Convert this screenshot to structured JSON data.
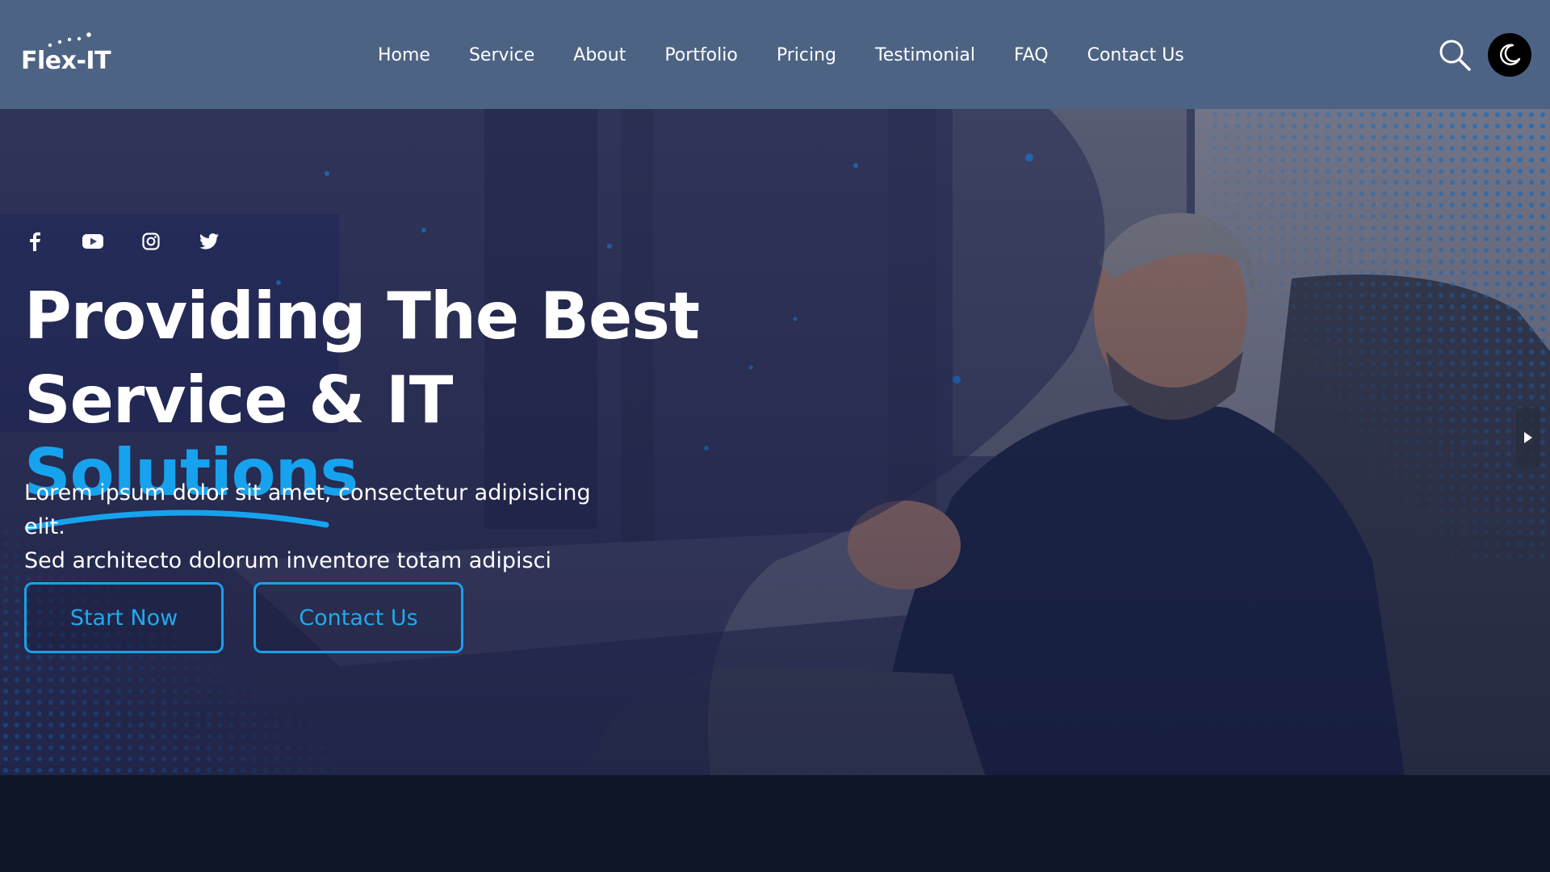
{
  "brand": {
    "name": "Flex-IT"
  },
  "nav": {
    "links": [
      "Home",
      "Service",
      "About",
      "Portfolio",
      "Pricing",
      "Testimonial",
      "FAQ",
      "Contact Us"
    ]
  },
  "header_icons": {
    "search": "search-icon",
    "theme": "moon-icon"
  },
  "hero": {
    "social": [
      "facebook-icon",
      "youtube-icon",
      "instagram-icon",
      "twitter-icon"
    ],
    "headline_line1": "Providing The Best",
    "headline_line2": "Service & IT",
    "headline_highlight": "Solutions",
    "subtext_line1": "Lorem ipsum dolor sit amet, consectetur adipisicing elit.",
    "subtext_line2": "Sed architecto dolorum inventore totam adipisci",
    "primary_button": "Start Now",
    "secondary_button": "Contact Us"
  },
  "colors": {
    "nav_bg": "#4d6384",
    "accent": "#17a2ee",
    "page_bg": "#0e1628",
    "theme_button": "#000000"
  }
}
